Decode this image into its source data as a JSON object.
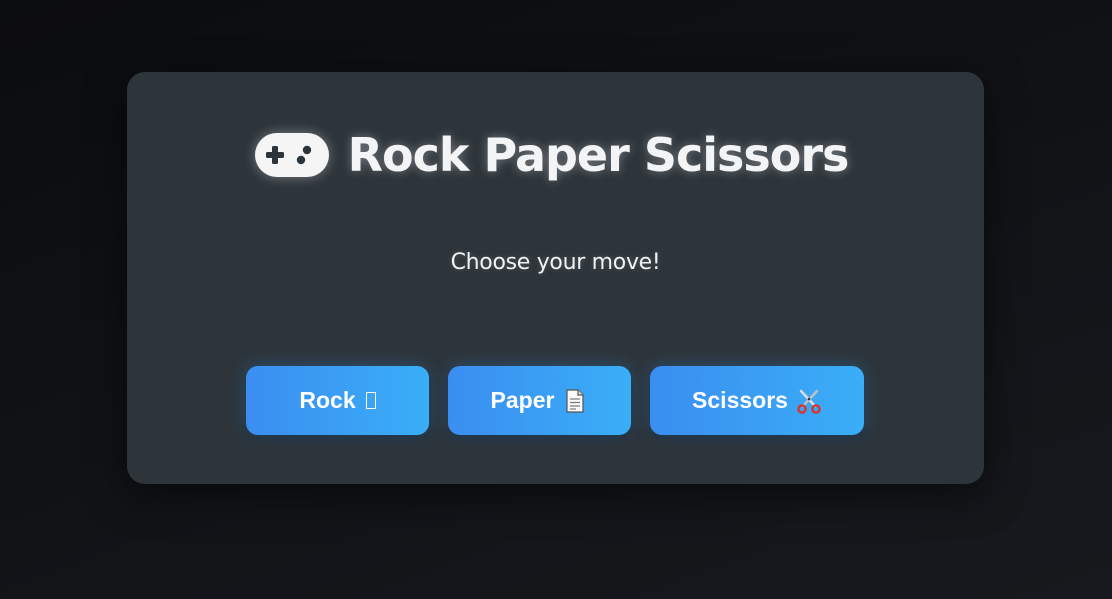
{
  "app": {
    "title": "Rock Paper Scissors",
    "title_icon": "game-controller-icon",
    "subtitle": "Choose your move!"
  },
  "moves": {
    "rock": {
      "label": "Rock",
      "icon": "missing-glyph-icon"
    },
    "paper": {
      "label": "Paper",
      "icon": "page-icon"
    },
    "scissors": {
      "label": "Scissors",
      "icon": "scissors-icon"
    }
  },
  "colors": {
    "background": "#0e1013",
    "card": "#2d353b",
    "button_gradient_start": "#3a8ef0",
    "button_gradient_end": "#3aaef7",
    "text": "#f3f4f5"
  }
}
